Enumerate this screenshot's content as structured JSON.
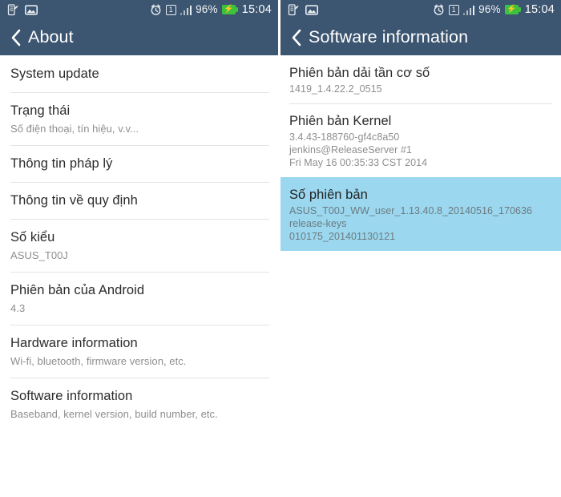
{
  "statusbar": {
    "icons_left": [
      "document-leaf-icon",
      "screenshot-image-icon"
    ],
    "alarm_icon": "alarm-clock-icon",
    "sim_label": "1",
    "signal_icon": "signal-bars-icon",
    "battery_percent": "96%",
    "battery_icon": "battery-charging-icon",
    "charging_glyph": "⚡",
    "clock": "15:04"
  },
  "colors": {
    "action_bar": "#3c5570",
    "status_bar": "#3c5570",
    "selection_highlight": "#9bd8ef",
    "battery_green": "#3ec23e",
    "title_text": "#2b2b2b",
    "subtitle_text": "#8e8e8e",
    "divider": "#e4e4e4"
  },
  "left_screen": {
    "back_icon": "back-chevron-icon",
    "title": "About",
    "items": [
      {
        "title": "System update",
        "sub": []
      },
      {
        "title": "Trạng thái",
        "sub": [
          "Số điện thoại, tín hiệu, v.v..."
        ]
      },
      {
        "title": "Thông tin pháp lý",
        "sub": []
      },
      {
        "title": "Thông tin về quy định",
        "sub": []
      },
      {
        "title": "Số kiểu",
        "sub": [
          "ASUS_T00J"
        ]
      },
      {
        "title": "Phiên bản của Android",
        "sub": [
          "4.3"
        ]
      },
      {
        "title": "Hardware information",
        "sub": [
          "Wi-fi, bluetooth, firmware version, etc."
        ]
      },
      {
        "title": "Software information",
        "sub": [
          "Baseband, kernel version, build number, etc."
        ]
      }
    ]
  },
  "right_screen": {
    "back_icon": "back-chevron-icon",
    "title": "Software information",
    "items": [
      {
        "title": "Phiên bản dải tần cơ số",
        "sub": [
          "1419_1.4.22.2_0515"
        ],
        "selected": false
      },
      {
        "title": "Phiên bản Kernel",
        "sub": [
          "3.4.43-188760-gf4c8a50",
          "jenkins@ReleaseServer #1",
          "Fri May 16 00:35:33 CST 2014"
        ],
        "selected": false
      },
      {
        "title": "Số phiên bản",
        "sub": [
          "ASUS_T00J_WW_user_1.13.40.8_20140516_170636 release-keys",
          "010175_201401130121"
        ],
        "selected": true
      }
    ]
  }
}
